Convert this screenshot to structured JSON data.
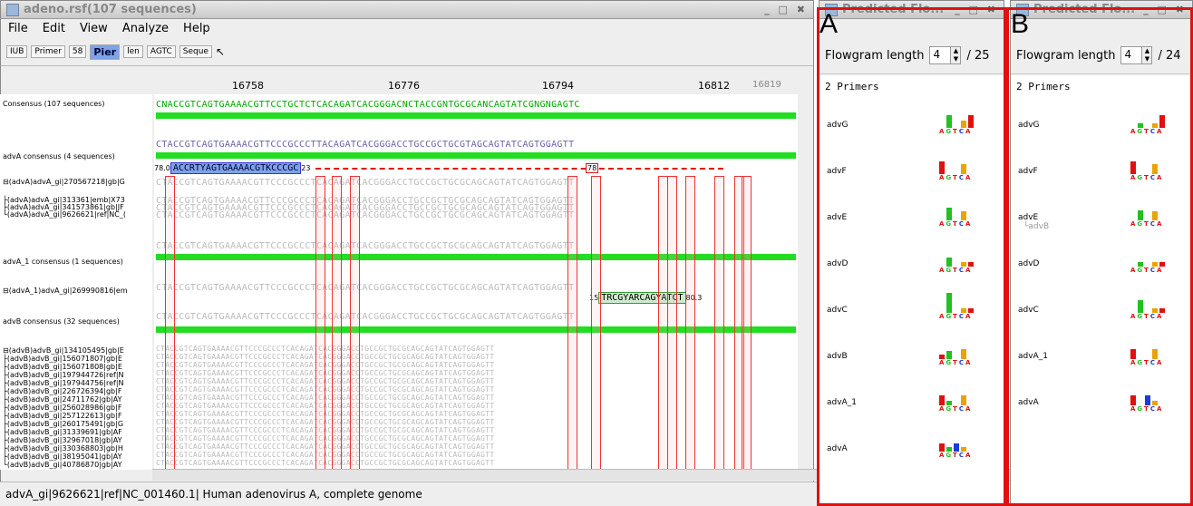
{
  "main": {
    "title": "adeno.rsf(107 sequences)",
    "menu": [
      "File",
      "Edit",
      "View",
      "Analyze",
      "Help"
    ],
    "toolbar": [
      "IUB",
      "Primer",
      "58",
      "Pier",
      "len",
      "AGTC",
      "Seque"
    ],
    "ruler": [
      "16758",
      "16776",
      "16794",
      "16812",
      "16819"
    ],
    "labels": [
      "Consensus (107 sequences)",
      "advA consensus (4 sequences)",
      "⊟(advA)advA_gi|270567218|gb|G",
      "├(advA)advA_gi|313361|emb|X73",
      "├(advA)advA_gi|341573861|gb|JF",
      "└(advA)advA_gi|9626621|ref|NC_(",
      "advA_1 consensus (1 sequences)",
      "⊟(advA_1)advA_gi|269990816|em",
      "advB consensus (32 sequences)",
      "⊟(advB)advB_gi|134105495|gb|E",
      "├(advB)advB_gi|156071807|gb|E",
      "├(advB)advB_gi|156071808|gb|E",
      "├(advB)advB_gi|197944726|ref|N",
      "├(advB)advB_gi|197944756|ref|N",
      "├(advB)advB_gi|226726394|gb|F",
      "├(advB)advB_gi|24711762|gb|AY",
      "├(advB)advB_gi|256028986|gb|F",
      "├(advB)advB_gi|257122613|gb|F",
      "├(advB)advB_gi|260175491|gb|G",
      "├(advB)advB_gi|31339691|gb|AF",
      "├(advB)advB_gi|32967018|gb|AY",
      "├(advB)advB_gi|330368803|gb|H",
      "├(advB)advB_gi|38195041|gb|AY",
      "└(advB)advB_gi|40786870|gb|AY"
    ],
    "consensus_seq": "CNACCGTCAGTGAAAACGTTCCTGCTCTCACAGATCACGGGACNCTACCGNTGCGCANCAGTATCGNGNGAGTC",
    "adva_seq": "CTACCGTCAGTGAAAACGTTCCCGCCCTTACAGATCACGGGACCTGCCGCTGCGTAGCAGTATCAGTGGAGTT",
    "row_seq": "CTACCGTCAGTGAAAACGTTCCCGCCCTCACAGATCACGGGACCTGCCGCTGCGCAGCAGTATCAGTGGAGTT",
    "primer_fwd": "ACCRTYAGTGAAAACGTKCCCGC",
    "primer_fwd_left": "78.0",
    "primer_fwd_right": "23",
    "primer_mid": "78",
    "primer_rev": "TRCGYARCAGYATCT",
    "primer_rev_left": "15",
    "primer_rev_right": "80.3",
    "status": "advA_gi|9626621|ref|NC_001460.1| Human adenovirus A, complete genome"
  },
  "panelA": {
    "title": "Predicted Flo...",
    "letter": "A",
    "length_label": "Flowgram length",
    "length_value": "4",
    "length_total": "/ 25",
    "primers_title": "2 Primers",
    "rows": [
      {
        "name": "advG",
        "sub": "",
        "bars": [
          {
            "c": "#22c022",
            "h": 14,
            "x": 8
          },
          {
            "c": "#e8a400",
            "h": 8,
            "x": 24
          },
          {
            "c": "#e01010",
            "h": 14,
            "x": 32
          }
        ]
      },
      {
        "name": "advF",
        "sub": "",
        "bars": [
          {
            "c": "#e01010",
            "h": 14,
            "x": 0
          },
          {
            "c": "#e8a400",
            "h": 11,
            "x": 24
          }
        ]
      },
      {
        "name": "advE",
        "sub": "",
        "bars": [
          {
            "c": "#22c022",
            "h": 14,
            "x": 8
          },
          {
            "c": "#e8a400",
            "h": 10,
            "x": 24
          }
        ]
      },
      {
        "name": "advD",
        "sub": "",
        "bars": [
          {
            "c": "#22c022",
            "h": 10,
            "x": 8
          },
          {
            "c": "#e8a400",
            "h": 5,
            "x": 24
          },
          {
            "c": "#e01010",
            "h": 5,
            "x": 32
          }
        ]
      },
      {
        "name": "advC",
        "sub": "",
        "bars": [
          {
            "c": "#22c022",
            "h": 22,
            "x": 8
          },
          {
            "c": "#e8a400",
            "h": 5,
            "x": 24
          },
          {
            "c": "#e01010",
            "h": 5,
            "x": 32
          }
        ]
      },
      {
        "name": "advB",
        "sub": "",
        "bars": [
          {
            "c": "#e01010",
            "h": 5,
            "x": 0
          },
          {
            "c": "#22c022",
            "h": 9,
            "x": 8
          },
          {
            "c": "#e8a400",
            "h": 11,
            "x": 24
          }
        ]
      },
      {
        "name": "advA_1",
        "sub": "",
        "bars": [
          {
            "c": "#e01010",
            "h": 11,
            "x": 0
          },
          {
            "c": "#22c022",
            "h": 5,
            "x": 8
          },
          {
            "c": "#e8a400",
            "h": 11,
            "x": 24
          }
        ]
      },
      {
        "name": "advA",
        "sub": "",
        "bars": [
          {
            "c": "#e01010",
            "h": 9,
            "x": 0
          },
          {
            "c": "#22c022",
            "h": 5,
            "x": 8
          },
          {
            "c": "#1a3cd8",
            "h": 9,
            "x": 16
          },
          {
            "c": "#e8a400",
            "h": 5,
            "x": 24
          }
        ]
      }
    ]
  },
  "panelB": {
    "title": "Predicted Flo...",
    "letter": "B",
    "length_label": "Flowgram length",
    "length_value": "4",
    "length_total": "/ 24",
    "primers_title": "2 Primers",
    "rows": [
      {
        "name": "advG",
        "sub": "",
        "bars": [
          {
            "c": "#22c022",
            "h": 5,
            "x": 8
          },
          {
            "c": "#e8a400",
            "h": 5,
            "x": 24
          },
          {
            "c": "#e01010",
            "h": 14,
            "x": 32
          }
        ]
      },
      {
        "name": "advF",
        "sub": "",
        "bars": [
          {
            "c": "#e01010",
            "h": 14,
            "x": 0
          },
          {
            "c": "#e8a400",
            "h": 11,
            "x": 24
          }
        ]
      },
      {
        "name": "advE",
        "sub": "└advB",
        "bars": [
          {
            "c": "#22c022",
            "h": 11,
            "x": 8
          },
          {
            "c": "#e8a400",
            "h": 10,
            "x": 24
          }
        ]
      },
      {
        "name": "advD",
        "sub": "",
        "bars": [
          {
            "c": "#22c022",
            "h": 5,
            "x": 8
          },
          {
            "c": "#e8a400",
            "h": 5,
            "x": 24
          },
          {
            "c": "#e01010",
            "h": 5,
            "x": 32
          }
        ]
      },
      {
        "name": "advC",
        "sub": "",
        "bars": [
          {
            "c": "#22c022",
            "h": 14,
            "x": 8
          },
          {
            "c": "#e8a400",
            "h": 5,
            "x": 24
          },
          {
            "c": "#e01010",
            "h": 5,
            "x": 32
          }
        ]
      },
      {
        "name": "advA_1",
        "sub": "",
        "bars": [
          {
            "c": "#e01010",
            "h": 11,
            "x": 0
          },
          {
            "c": "#e8a400",
            "h": 11,
            "x": 24
          }
        ]
      },
      {
        "name": "advA",
        "sub": "",
        "bars": [
          {
            "c": "#e01010",
            "h": 11,
            "x": 0
          },
          {
            "c": "#1a3cd8",
            "h": 11,
            "x": 16
          },
          {
            "c": "#e8a400",
            "h": 5,
            "x": 24
          }
        ]
      }
    ]
  },
  "bases": "AGTCA"
}
